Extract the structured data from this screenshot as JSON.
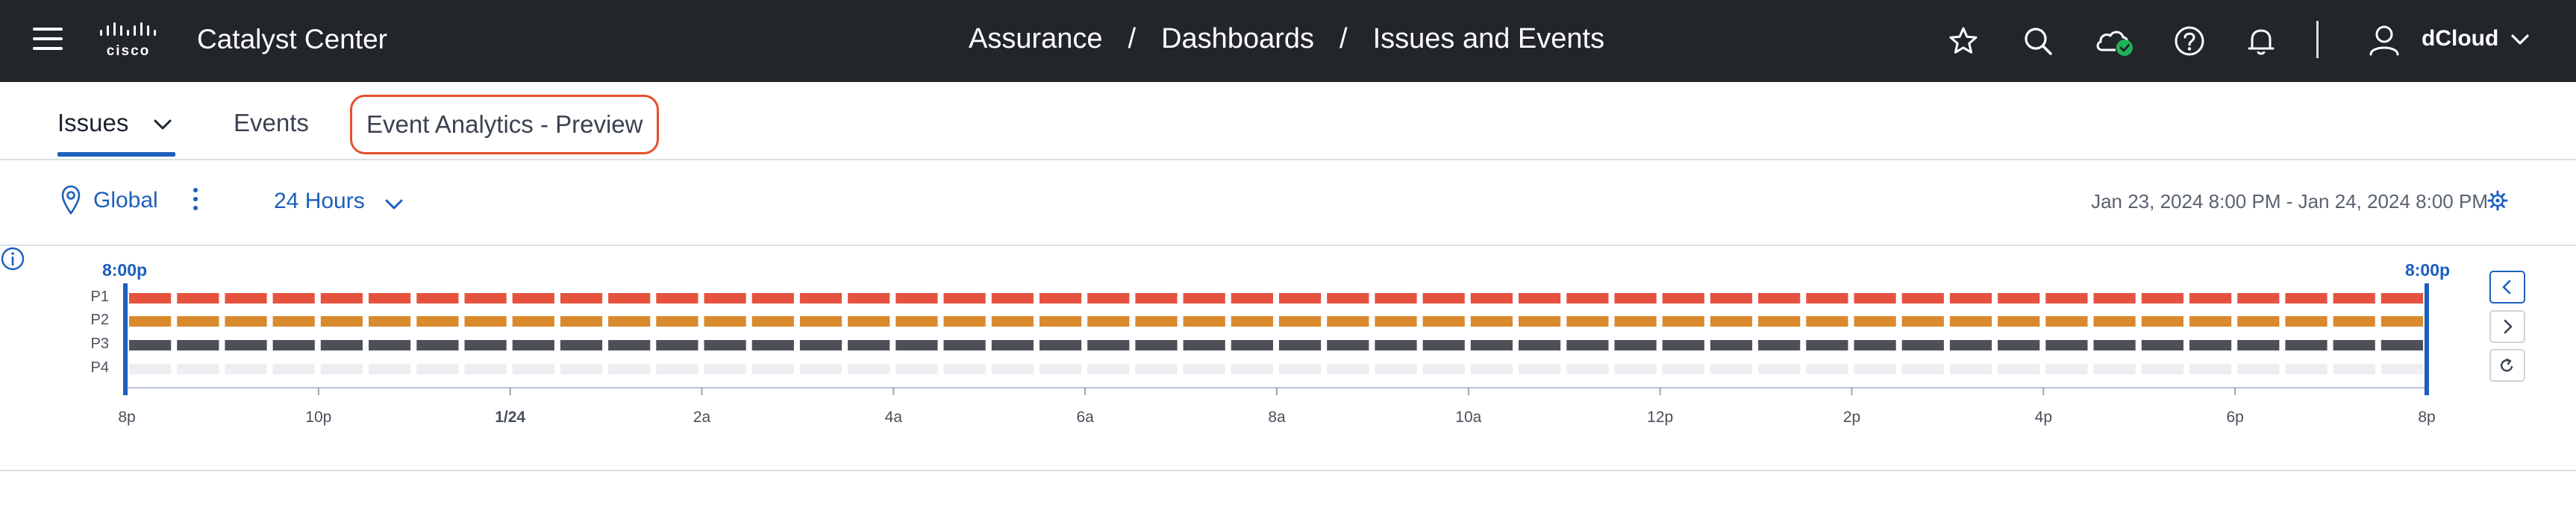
{
  "header": {
    "app_title": "Catalyst Center",
    "logo_text": "cisco",
    "breadcrumb": [
      "Assurance",
      "Dashboards",
      "Issues and Events"
    ],
    "breadcrumb_separator": "/",
    "user": {
      "name": "dCloud"
    },
    "icons": [
      "menu-icon",
      "star-icon",
      "search-icon",
      "cloud-status-icon",
      "help-icon",
      "bell-icon",
      "user-icon",
      "chevron-down-icon"
    ]
  },
  "tabs": {
    "issues": "Issues",
    "events": "Events",
    "analytics": "Event Analytics - Preview",
    "active": "Issues"
  },
  "filters": {
    "site": "Global",
    "time_range": "24 Hours",
    "date_range": "Jan 23, 2024 8:00 PM - Jan 24, 2024 8:00 PM"
  },
  "timeline": {
    "start_label": "8:00p",
    "end_label": "8:00p",
    "rows": [
      {
        "label": "P1",
        "color": "#e5533f"
      },
      {
        "label": "P2",
        "color": "#d88a2c"
      },
      {
        "label": "P3",
        "color": "#4d5157"
      },
      {
        "label": "P4",
        "color": "#eceef1"
      }
    ],
    "segments_per_row": 48,
    "x_ticks": [
      "8p",
      "10p",
      "1/24",
      "2a",
      "4a",
      "6a",
      "8a",
      "10a",
      "12p",
      "2p",
      "4p",
      "6p",
      "8p"
    ],
    "bold_tick": "1/24"
  },
  "colors": {
    "accent": "#1c5fbd",
    "topbar": "#22252a",
    "highlight": "#e4502d",
    "status_ok": "#1fb457"
  }
}
